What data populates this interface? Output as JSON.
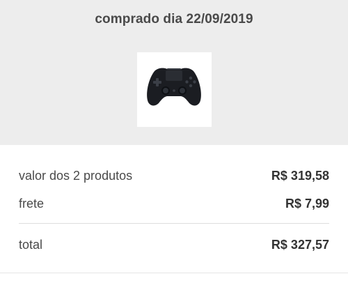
{
  "header": {
    "title": "comprado dia 22/09/2019"
  },
  "product": {
    "image_icon": "game-controller-icon",
    "image_alt": ""
  },
  "summary": {
    "items_label": "valor dos 2 produtos",
    "items_value": "R$ 319,58",
    "shipping_label": "frete",
    "shipping_value": "R$ 7,99",
    "total_label": "total",
    "total_value": "R$ 327,57"
  },
  "colors": {
    "header_background": "#ededed",
    "text": "#4a4a4a",
    "value_text": "#333333",
    "divider": "#dedede"
  }
}
